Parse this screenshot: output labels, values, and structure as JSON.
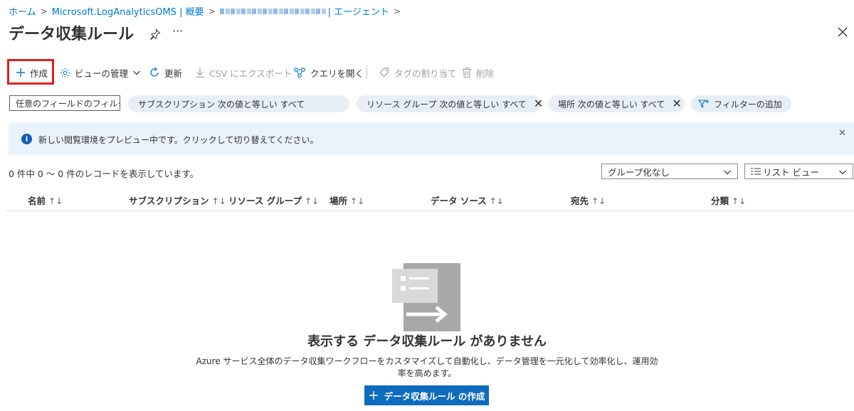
{
  "breadcrumb": {
    "items": [
      "ホーム",
      "Microsoft.LogAnalyticsOMS | 概要",
      "| エージェント"
    ],
    "separator": ">"
  },
  "header": {
    "title": "データ収集ルール",
    "more": "···"
  },
  "toolbar": {
    "create": "作成",
    "manage_view": "ビューの管理",
    "refresh": "更新",
    "export_csv": "CSV にエクスポート",
    "open_query": "クエリを開く",
    "assign_tags": "タグの割り当て",
    "delete": "削除"
  },
  "filters": {
    "search_placeholder": "任意のフィールドのフィルタ",
    "subscription": "サブスクリプション 次の値と等しい すべて",
    "resource_group": "リソース グループ 次の値と等しい すべて",
    "location": "場所 次の値と等しい すべて",
    "add_filter": "フィルターの追加"
  },
  "banner": {
    "text": "新しい閲覧環境をプレビュー中です。クリックして切り替えてください。"
  },
  "records": {
    "count_text": "0 件中 0 ～ 0 件のレコードを表示しています。",
    "grouping": "グループ化なし",
    "view": "リスト ビュー"
  },
  "table": {
    "columns": [
      "名前",
      "サブスクリプション",
      "リソース グループ",
      "場所",
      "データ ソース",
      "宛先",
      "分類"
    ],
    "sort_glyph": "↑↓"
  },
  "empty_state": {
    "title": "表示する データ収集ルール がありません",
    "description": "Azure サービス全体のデータ収集ワークフローをカスタマイズして自動化し、データ管理を一元化して効率化し、運用効率を高めます。",
    "button": "データ収集ルール の作成"
  },
  "colors": {
    "link": "#0078d4",
    "primary_button": "#0f6cbd",
    "highlight": "#e0201c",
    "pill": "#e8eef6",
    "banner": "#eaf3fb"
  }
}
